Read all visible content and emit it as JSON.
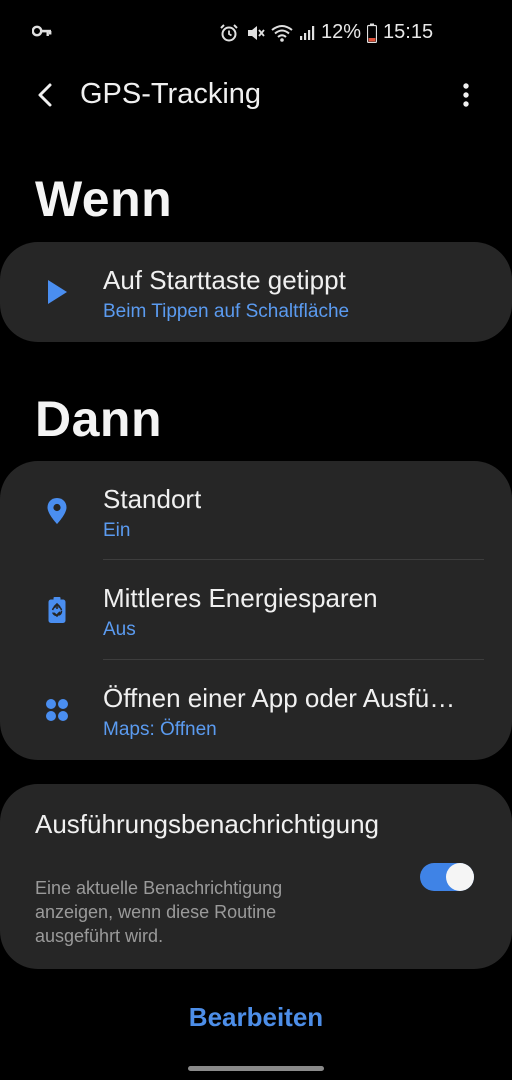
{
  "status_bar": {
    "battery": "12%",
    "time": "15:15"
  },
  "app_bar": {
    "title": "GPS-Tracking"
  },
  "when_section": {
    "heading": "Wenn",
    "trigger": {
      "title": "Auf Starttaste getippt",
      "subtitle": "Beim Tippen auf Schaltfläche"
    }
  },
  "then_section": {
    "heading": "Dann",
    "actions": [
      {
        "title": "Standort",
        "subtitle": "Ein",
        "icon": "location-pin-icon"
      },
      {
        "title": "Mittleres Energiesparen",
        "subtitle": "Aus",
        "icon": "battery-saver-icon"
      },
      {
        "title": "Öffnen einer App oder Ausfü…",
        "subtitle": "Maps: Öffnen",
        "icon": "apps-grid-icon"
      }
    ]
  },
  "notification": {
    "title": "Ausführungsbenachrichtigung",
    "description": "Eine aktuelle Benachrichtigung anzeigen, wenn diese Routine ausgeführt wird.",
    "enabled": true
  },
  "footer": {
    "edit_label": "Bearbeiten"
  },
  "colors": {
    "accent": "#5b9bf0",
    "toggle_on": "#3f83e6",
    "card": "#262626",
    "background": "#000000"
  }
}
